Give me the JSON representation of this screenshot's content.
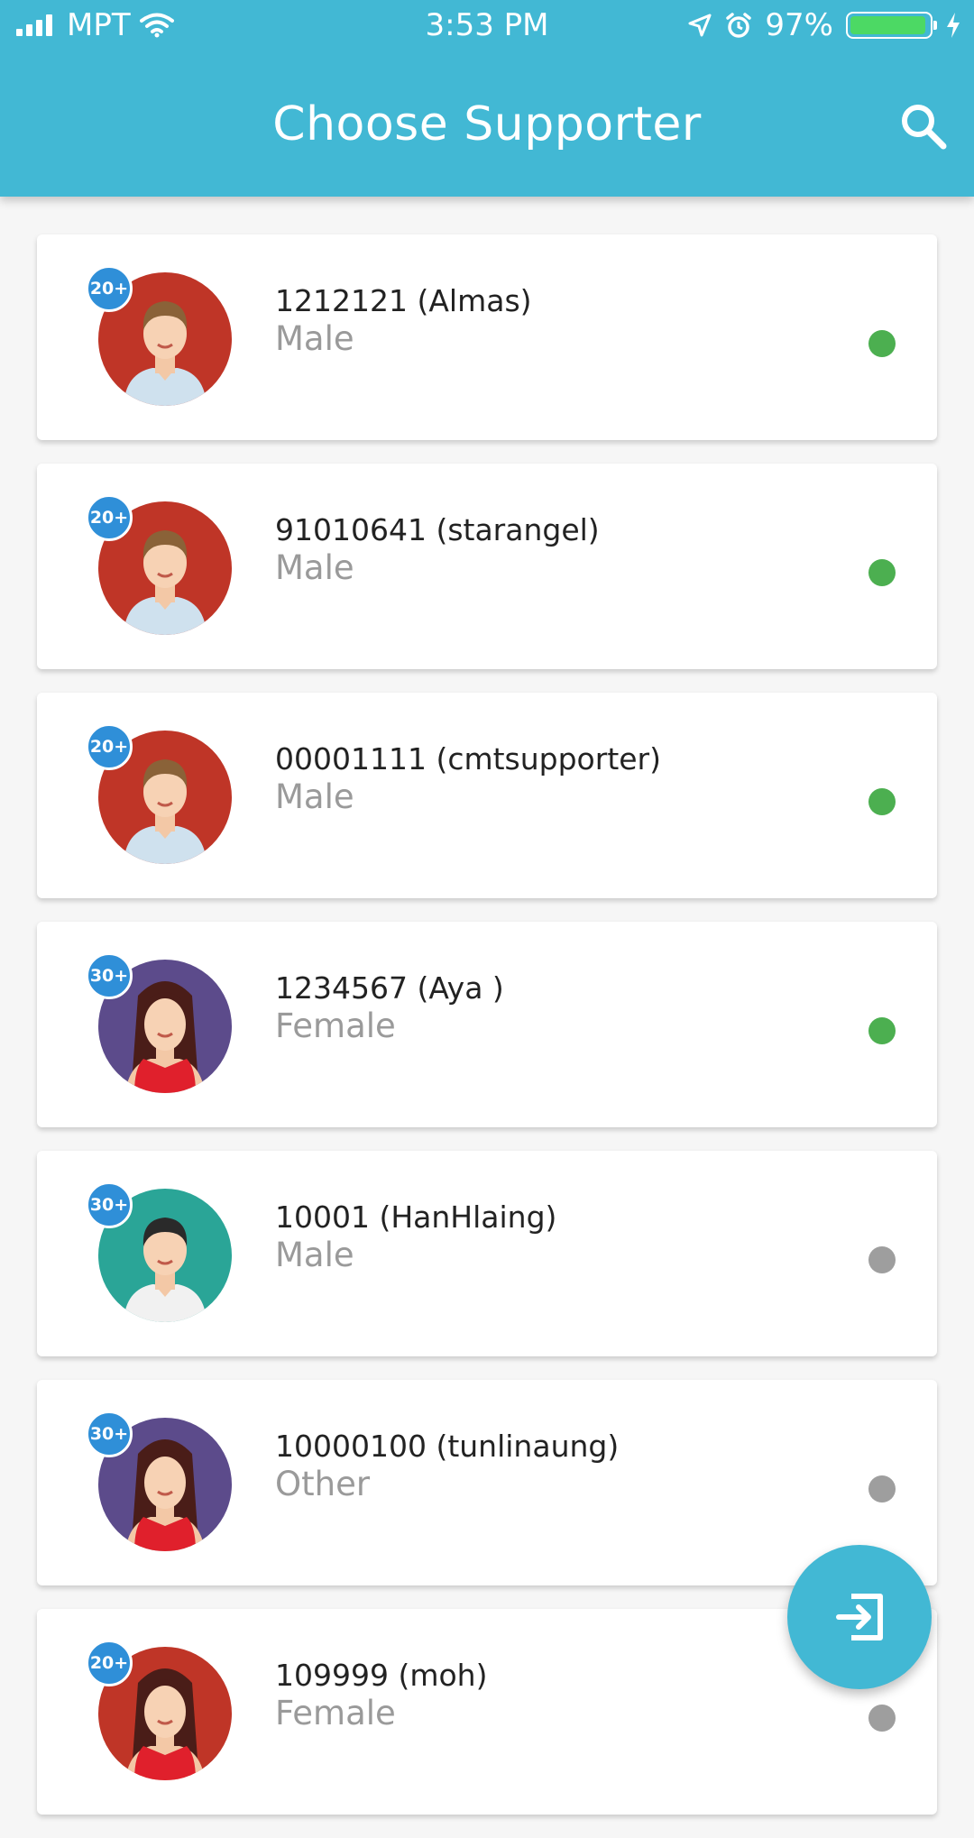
{
  "status_bar": {
    "carrier": "MPT",
    "time": "3:53 PM",
    "battery": "97%",
    "battery_level": 0.97,
    "icons": [
      "signal-icon",
      "wifi-icon",
      "location-icon",
      "alarm-icon",
      "battery-icon",
      "charging-icon"
    ]
  },
  "header": {
    "title": "Choose Supporter",
    "search_icon": "search-icon"
  },
  "supporters": [
    {
      "name": "1212121 (Almas)",
      "gender": "Male",
      "age_badge": "20+",
      "avatar": "male-brown",
      "online": true
    },
    {
      "name": "91010641 (starangel)",
      "gender": "Male",
      "age_badge": "20+",
      "avatar": "male-brown",
      "online": true
    },
    {
      "name": "00001111 (cmtsupporter)",
      "gender": "Male",
      "age_badge": "20+",
      "avatar": "male-brown",
      "online": true
    },
    {
      "name": "1234567 (Aya )",
      "gender": "Female",
      "age_badge": "30+",
      "avatar": "female-purple",
      "online": true
    },
    {
      "name": "10001 (HanHlaing)",
      "gender": "Male",
      "age_badge": "30+",
      "avatar": "male-teal",
      "online": false
    },
    {
      "name": "10000100 (tunlinaung)",
      "gender": "Other",
      "age_badge": "30+",
      "avatar": "female-purple",
      "online": false
    },
    {
      "name": "109999 (moh)",
      "gender": "Female",
      "age_badge": "20+",
      "avatar": "female-red",
      "online": false
    }
  ],
  "fab": {
    "icon": "logout-icon"
  },
  "colors": {
    "primary": "#42b8d4",
    "online": "#4caf50",
    "offline": "#9e9e9e",
    "badge": "#2f8fd8"
  }
}
